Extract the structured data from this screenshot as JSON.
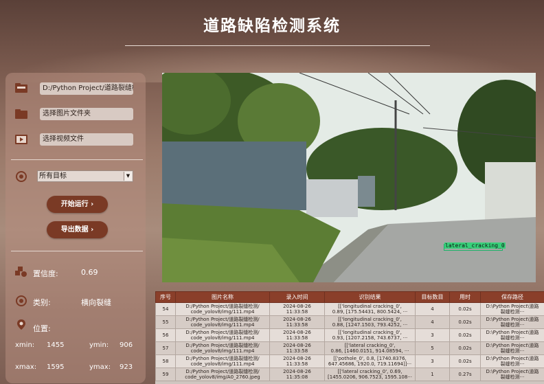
{
  "app": {
    "title": "道路缺陷检测系统"
  },
  "sources": {
    "weights_path": "D:/Python Project/道路裂缝检",
    "image_folder_label": "选择图片文件夹",
    "video_file_label": "选择视频文件"
  },
  "target_select": {
    "selected": "所有目标"
  },
  "buttons": {
    "run": "开始运行 ›",
    "export": "导出数据 ›"
  },
  "result": {
    "confidence_label": "置信度:",
    "confidence_value": "0.69",
    "class_label": "类别:",
    "class_value": "横向裂缝",
    "position_label": "位置:",
    "xmin_label": "xmin:",
    "xmin": "1455",
    "ymin_label": "ymin:",
    "ymin": "906",
    "xmax_label": "xmax:",
    "xmax": "1595",
    "ymax_label": "ymax:",
    "ymax": "923"
  },
  "detection": {
    "label": "lateral_cracking_0"
  },
  "table": {
    "headers": [
      "序号",
      "图片名称",
      "录入时间",
      "识别结果",
      "目标数目",
      "用时",
      "保存路径"
    ],
    "rows": [
      {
        "id": "54",
        "name1": "D:/Python Project/道路裂缝检测/",
        "name2": "code_yolov8/img/111.mp4",
        "date": "2024-08-26",
        "time": "11:33:58",
        "res1": "[['longitudinal cracking_0',",
        "res2": "0.89, [175.54431, 800.5424, ···",
        "count": "4",
        "dur": "0.02s",
        "save1": "D:\\Python Project\\道路",
        "save2": "裂缝检测···"
      },
      {
        "id": "55",
        "name1": "D:/Python Project/道路裂缝检测/",
        "name2": "code_yolov8/img/111.mp4",
        "date": "2024-08-26",
        "time": "11:33:58",
        "res1": "[['longitudinal cracking_0',",
        "res2": "0.88, [1247.1503, 793.4252, ···",
        "count": "4",
        "dur": "0.02s",
        "save1": "D:\\Python Project\\道路",
        "save2": "裂缝检测···"
      },
      {
        "id": "56",
        "name1": "D:/Python Project/道路裂缝检测/",
        "name2": "code_yolov8/img/111.mp4",
        "date": "2024-08-26",
        "time": "11:33:58",
        "res1": "[['longitudinal cracking_0',",
        "res2": "0.93, [1207.2158, 743.6737, ···",
        "count": "3",
        "dur": "0.02s",
        "save1": "D:\\Python Project\\道路",
        "save2": "裂缝检测···"
      },
      {
        "id": "57",
        "name1": "D:/Python Project/道路裂缝检测/",
        "name2": "code_yolov8/img/111.mp4",
        "date": "2024-08-26",
        "time": "11:33:58",
        "res1": "[['lateral cracking_0',",
        "res2": "0.86, [1460.0151, 914.08594, ···",
        "count": "5",
        "dur": "0.02s",
        "save1": "D:\\Python Project\\道路",
        "save2": "裂缝检测···"
      },
      {
        "id": "58",
        "name1": "D:/Python Project/道路裂缝检测/",
        "name2": "code_yolov8/img/111.mp4",
        "date": "2024-08-26",
        "time": "11:33:58",
        "res1": "[['pothole_0', 0.8, [1740.8376,",
        "res2": "647.45686, 1920.0, 719.11694]]···",
        "count": "3",
        "dur": "0.02s",
        "save1": "D:\\Python Project\\道路",
        "save2": "裂缝检测···"
      },
      {
        "id": "59",
        "name1": "D:/Python Project/道路裂缝检测/",
        "name2": "code_yolov8/img/A0_2760.jpeg",
        "date": "2024-08-26",
        "time": "11:35:08",
        "res1": "[['lateral cracking_0', 0.69,",
        "res2": "[1455.0206, 906.7523, 1595.108···",
        "count": "1",
        "dur": "0.27s",
        "save1": "D:\\Python Project\\道路",
        "save2": "裂缝检测···"
      }
    ]
  },
  "colors": {
    "accent": "#7a3a25",
    "table_header": "#8a3f2a",
    "detection_box": "#1db36a"
  },
  "icons": [
    "weights-folder-icon",
    "image-folder-icon",
    "video-file-icon",
    "target-icon",
    "confidence-icon",
    "class-icon",
    "location-icon"
  ]
}
